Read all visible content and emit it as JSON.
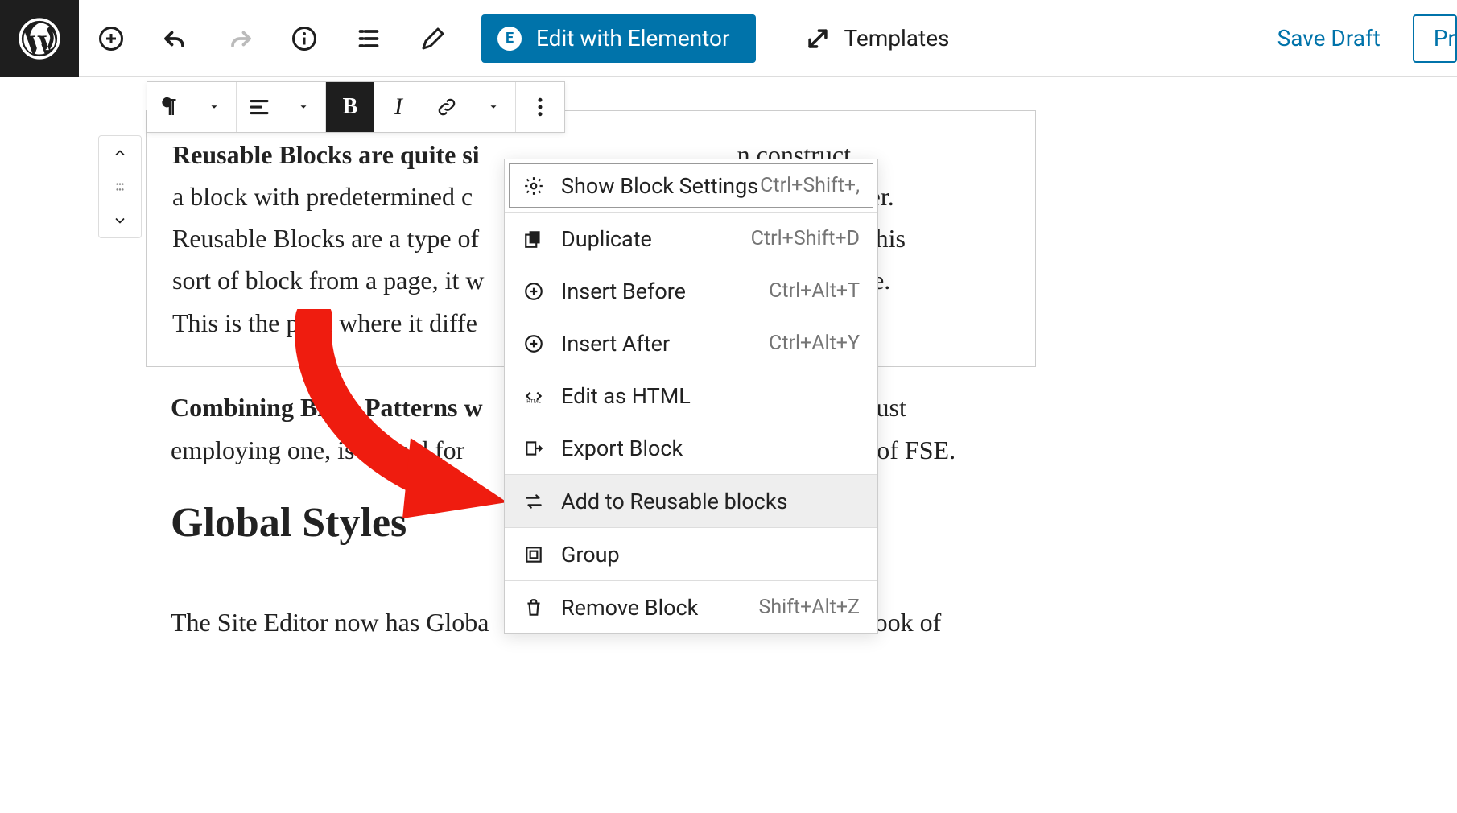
{
  "topbar": {
    "elementor_label": "Edit with Elementor",
    "templates_label": "Templates",
    "save_draft_label": "Save Draft",
    "preview_label": "Pr"
  },
  "paragraph1": {
    "bold_lead": "Reusable Blocks are quite si",
    "rest_line1_tail": "n construct",
    "line2_pre": "a block with predetermined c",
    "line2_tail": "use it later.",
    "line3_pre": "Reusable Blocks are a type of ",
    "line3_tail": "odify this",
    "line4_pre": "sort of block from a page, it w",
    "line4_tail": "the website.",
    "line5_pre": "This is the p   int where it diffe"
  },
  "paragraph2": {
    "bold": "Combining Blo   k Patterns w",
    "tail1": "just",
    "line2_pre": "employing one, is a   vis   d for ",
    "line2_tail": "ation of FSE."
  },
  "heading": "Global Styles",
  "paragraph3": {
    "line1_pre": "The Site Editor now has Globa",
    "line1_tail": "e look of"
  },
  "dropdown": {
    "show_settings": {
      "label": "Show Block Settings",
      "shortcut": "Ctrl+Shift+,"
    },
    "duplicate": {
      "label": "Duplicate",
      "shortcut": "Ctrl+Shift+D"
    },
    "insert_before": {
      "label": "Insert Before",
      "shortcut": "Ctrl+Alt+T"
    },
    "insert_after": {
      "label": "Insert After",
      "shortcut": "Ctrl+Alt+Y"
    },
    "edit_html": {
      "label": "Edit as HTML"
    },
    "export_block": {
      "label": "Export Block"
    },
    "add_reusable": {
      "label": "Add to Reusable blocks"
    },
    "group": {
      "label": "Group"
    },
    "remove_block": {
      "label": "Remove Block",
      "shortcut": "Shift+Alt+Z"
    }
  }
}
